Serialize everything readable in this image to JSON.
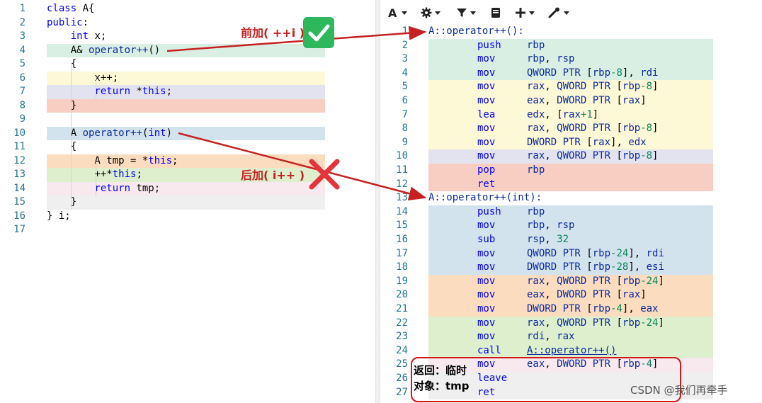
{
  "colors": {
    "green": "#d9efe4",
    "yellow": "#fdf8d6",
    "lavender": "#e3e3ef",
    "salmon": "#f9cec2",
    "blue": "#d3e3ee",
    "orange": "#fbdcbf",
    "lime": "#ddefcd",
    "pink": "#f8e9ee",
    "annotation": "#c62020"
  },
  "toolbar": {
    "buttons": [
      {
        "name": "font-size-button",
        "icon": "font-size-icon"
      },
      {
        "name": "settings-button",
        "icon": "gear-icon"
      },
      {
        "name": "filter-button",
        "icon": "filter-icon"
      },
      {
        "name": "libraries-button",
        "icon": "book-icon"
      },
      {
        "name": "add-button",
        "icon": "plus-icon"
      },
      {
        "name": "tools-button",
        "icon": "wrench-icon"
      }
    ]
  },
  "source": {
    "lines": [
      {
        "n": "1",
        "band": "",
        "segs": [
          [
            "kw",
            "class"
          ],
          [
            "plain",
            " A{"
          ]
        ]
      },
      {
        "n": "2",
        "band": "",
        "segs": [
          [
            "kw",
            "public"
          ],
          [
            "plain",
            ":"
          ]
        ]
      },
      {
        "n": "3",
        "band": "",
        "segs": [
          [
            "plain",
            "    "
          ],
          [
            "kw",
            "int"
          ],
          [
            "plain",
            " x;"
          ]
        ]
      },
      {
        "n": "4",
        "band": "green",
        "segs": [
          [
            "plain",
            "    A& "
          ],
          [
            "fn",
            "operator++"
          ],
          [
            "plain",
            "()"
          ]
        ]
      },
      {
        "n": "5",
        "band": "",
        "segs": [
          [
            "plain",
            "    {"
          ]
        ]
      },
      {
        "n": "6",
        "band": "yellow",
        "segs": [
          [
            "plain",
            "        x++;"
          ]
        ]
      },
      {
        "n": "7",
        "band": "lavender",
        "segs": [
          [
            "plain",
            "        "
          ],
          [
            "kw",
            "return"
          ],
          [
            "plain",
            " *"
          ],
          [
            "kw",
            "this"
          ],
          [
            "plain",
            ";"
          ]
        ]
      },
      {
        "n": "8",
        "band": "salmon",
        "segs": [
          [
            "plain",
            "    }"
          ]
        ]
      },
      {
        "n": "9",
        "band": "",
        "segs": []
      },
      {
        "n": "10",
        "band": "blue",
        "segs": [
          [
            "plain",
            "    A "
          ],
          [
            "fn",
            "operator++"
          ],
          [
            "plain",
            "("
          ],
          [
            "kw",
            "int"
          ],
          [
            "plain",
            ")"
          ]
        ]
      },
      {
        "n": "11",
        "band": "",
        "segs": [
          [
            "plain",
            "    {"
          ]
        ]
      },
      {
        "n": "12",
        "band": "orange",
        "segs": [
          [
            "plain",
            "        A tmp = *"
          ],
          [
            "kw",
            "this"
          ],
          [
            "plain",
            ";"
          ]
        ]
      },
      {
        "n": "13",
        "band": "lime",
        "segs": [
          [
            "plain",
            "        ++*"
          ],
          [
            "kw",
            "this"
          ],
          [
            "plain",
            ";"
          ]
        ]
      },
      {
        "n": "14",
        "band": "pink",
        "segs": [
          [
            "plain",
            "        "
          ],
          [
            "kw",
            "return"
          ],
          [
            "plain",
            " tmp;"
          ]
        ]
      },
      {
        "n": "15",
        "band": "gray",
        "segs": [
          [
            "plain",
            "    }"
          ]
        ]
      },
      {
        "n": "16",
        "band": "",
        "segs": [
          [
            "plain",
            "} i;"
          ]
        ]
      },
      {
        "n": "17",
        "band": "",
        "segs": []
      }
    ]
  },
  "asm": {
    "lines": [
      {
        "n": "1",
        "band": "",
        "label": "A::operator++():",
        "op": "",
        "args": []
      },
      {
        "n": "2",
        "band": "green",
        "label": "",
        "op": "push",
        "args": [
          [
            "reg",
            "rbp"
          ]
        ]
      },
      {
        "n": "3",
        "band": "green",
        "label": "",
        "op": "mov",
        "args": [
          [
            "reg",
            "rbp"
          ],
          [
            "ptr",
            ", "
          ],
          [
            "reg",
            "rsp"
          ]
        ]
      },
      {
        "n": "4",
        "band": "green",
        "label": "",
        "op": "mov",
        "args": [
          [
            "reg",
            "QWORD PTR "
          ],
          [
            "ptr",
            "["
          ],
          [
            "reg",
            "rbp"
          ],
          [
            "num",
            "-8"
          ],
          [
            "ptr",
            "], "
          ],
          [
            "reg",
            "rdi"
          ]
        ]
      },
      {
        "n": "5",
        "band": "yellow",
        "label": "",
        "op": "mov",
        "args": [
          [
            "reg",
            "rax"
          ],
          [
            "ptr",
            ", "
          ],
          [
            "reg",
            "QWORD PTR "
          ],
          [
            "ptr",
            "["
          ],
          [
            "reg",
            "rbp"
          ],
          [
            "num",
            "-8"
          ],
          [
            "ptr",
            "]"
          ]
        ]
      },
      {
        "n": "6",
        "band": "yellow",
        "label": "",
        "op": "mov",
        "args": [
          [
            "reg",
            "eax"
          ],
          [
            "ptr",
            ", "
          ],
          [
            "reg",
            "DWORD PTR "
          ],
          [
            "ptr",
            "["
          ],
          [
            "reg",
            "rax"
          ],
          [
            "ptr",
            "]"
          ]
        ]
      },
      {
        "n": "7",
        "band": "yellow",
        "label": "",
        "op": "lea",
        "args": [
          [
            "reg",
            "edx"
          ],
          [
            "ptr",
            ", ["
          ],
          [
            "reg",
            "rax"
          ],
          [
            "num",
            "+1"
          ],
          [
            "ptr",
            "]"
          ]
        ]
      },
      {
        "n": "8",
        "band": "yellow",
        "label": "",
        "op": "mov",
        "args": [
          [
            "reg",
            "rax"
          ],
          [
            "ptr",
            ", "
          ],
          [
            "reg",
            "QWORD PTR "
          ],
          [
            "ptr",
            "["
          ],
          [
            "reg",
            "rbp"
          ],
          [
            "num",
            "-8"
          ],
          [
            "ptr",
            "]"
          ]
        ]
      },
      {
        "n": "9",
        "band": "yellow",
        "label": "",
        "op": "mov",
        "args": [
          [
            "reg",
            "DWORD PTR "
          ],
          [
            "ptr",
            "["
          ],
          [
            "reg",
            "rax"
          ],
          [
            "ptr",
            "], "
          ],
          [
            "reg",
            "edx"
          ]
        ]
      },
      {
        "n": "10",
        "band": "lavender",
        "label": "",
        "op": "mov",
        "args": [
          [
            "reg",
            "rax"
          ],
          [
            "ptr",
            ", "
          ],
          [
            "reg",
            "QWORD PTR "
          ],
          [
            "ptr",
            "["
          ],
          [
            "reg",
            "rbp"
          ],
          [
            "num",
            "-8"
          ],
          [
            "ptr",
            "]"
          ]
        ]
      },
      {
        "n": "11",
        "band": "salmon",
        "label": "",
        "op": "pop",
        "args": [
          [
            "reg",
            "rbp"
          ]
        ]
      },
      {
        "n": "12",
        "band": "salmon",
        "label": "",
        "op": "ret",
        "args": []
      },
      {
        "n": "13",
        "band": "",
        "label": "A::operator++(int):",
        "op": "",
        "args": []
      },
      {
        "n": "14",
        "band": "blue",
        "label": "",
        "op": "push",
        "args": [
          [
            "reg",
            "rbp"
          ]
        ]
      },
      {
        "n": "15",
        "band": "blue",
        "label": "",
        "op": "mov",
        "args": [
          [
            "reg",
            "rbp"
          ],
          [
            "ptr",
            ", "
          ],
          [
            "reg",
            "rsp"
          ]
        ]
      },
      {
        "n": "16",
        "band": "blue",
        "label": "",
        "op": "sub",
        "args": [
          [
            "reg",
            "rsp"
          ],
          [
            "ptr",
            ", "
          ],
          [
            "num",
            "32"
          ]
        ]
      },
      {
        "n": "17",
        "band": "blue",
        "label": "",
        "op": "mov",
        "args": [
          [
            "reg",
            "QWORD PTR "
          ],
          [
            "ptr",
            "["
          ],
          [
            "reg",
            "rbp"
          ],
          [
            "num",
            "-24"
          ],
          [
            "ptr",
            "], "
          ],
          [
            "reg",
            "rdi"
          ]
        ]
      },
      {
        "n": "18",
        "band": "blue",
        "label": "",
        "op": "mov",
        "args": [
          [
            "reg",
            "DWORD PTR "
          ],
          [
            "ptr",
            "["
          ],
          [
            "reg",
            "rbp"
          ],
          [
            "num",
            "-28"
          ],
          [
            "ptr",
            "], "
          ],
          [
            "reg",
            "esi"
          ]
        ]
      },
      {
        "n": "19",
        "band": "orange",
        "label": "",
        "op": "mov",
        "args": [
          [
            "reg",
            "rax"
          ],
          [
            "ptr",
            ", "
          ],
          [
            "reg",
            "QWORD PTR "
          ],
          [
            "ptr",
            "["
          ],
          [
            "reg",
            "rbp"
          ],
          [
            "num",
            "-24"
          ],
          [
            "ptr",
            "]"
          ]
        ]
      },
      {
        "n": "20",
        "band": "orange",
        "label": "",
        "op": "mov",
        "args": [
          [
            "reg",
            "eax"
          ],
          [
            "ptr",
            ", "
          ],
          [
            "reg",
            "DWORD PTR "
          ],
          [
            "ptr",
            "["
          ],
          [
            "reg",
            "rax"
          ],
          [
            "ptr",
            "]"
          ]
        ]
      },
      {
        "n": "21",
        "band": "orange",
        "label": "",
        "op": "mov",
        "args": [
          [
            "reg",
            "DWORD PTR "
          ],
          [
            "ptr",
            "["
          ],
          [
            "reg",
            "rbp"
          ],
          [
            "num",
            "-4"
          ],
          [
            "ptr",
            "], "
          ],
          [
            "reg",
            "eax"
          ]
        ]
      },
      {
        "n": "22",
        "band": "lime",
        "label": "",
        "op": "mov",
        "args": [
          [
            "reg",
            "rax"
          ],
          [
            "ptr",
            ", "
          ],
          [
            "reg",
            "QWORD PTR "
          ],
          [
            "ptr",
            "["
          ],
          [
            "reg",
            "rbp"
          ],
          [
            "num",
            "-24"
          ],
          [
            "ptr",
            "]"
          ]
        ]
      },
      {
        "n": "23",
        "band": "lime",
        "label": "",
        "op": "mov",
        "args": [
          [
            "reg",
            "rdi"
          ],
          [
            "ptr",
            ", "
          ],
          [
            "reg",
            "rax"
          ]
        ]
      },
      {
        "n": "24",
        "band": "lime",
        "label": "",
        "op": "call",
        "args": [
          [
            "link",
            "A::operator++()"
          ]
        ]
      },
      {
        "n": "25",
        "band": "pink",
        "label": "",
        "op": "mov",
        "args": [
          [
            "reg",
            "eax"
          ],
          [
            "ptr",
            ", "
          ],
          [
            "reg",
            "DWORD PTR "
          ],
          [
            "ptr",
            "["
          ],
          [
            "reg",
            "rbp"
          ],
          [
            "num",
            "-4"
          ],
          [
            "ptr",
            "]"
          ]
        ]
      },
      {
        "n": "26",
        "band": "gray",
        "label": "",
        "op": "leave",
        "args": []
      },
      {
        "n": "27",
        "band": "gray",
        "label": "",
        "op": "ret",
        "args": []
      }
    ]
  },
  "annotations": {
    "prefix_label": "前加( ++i )",
    "postfix_label": "后加( i++ )",
    "return_line1": "返回：临时",
    "return_line2": "对象：tmp",
    "watermark": "CSDN @我们再牵手"
  }
}
